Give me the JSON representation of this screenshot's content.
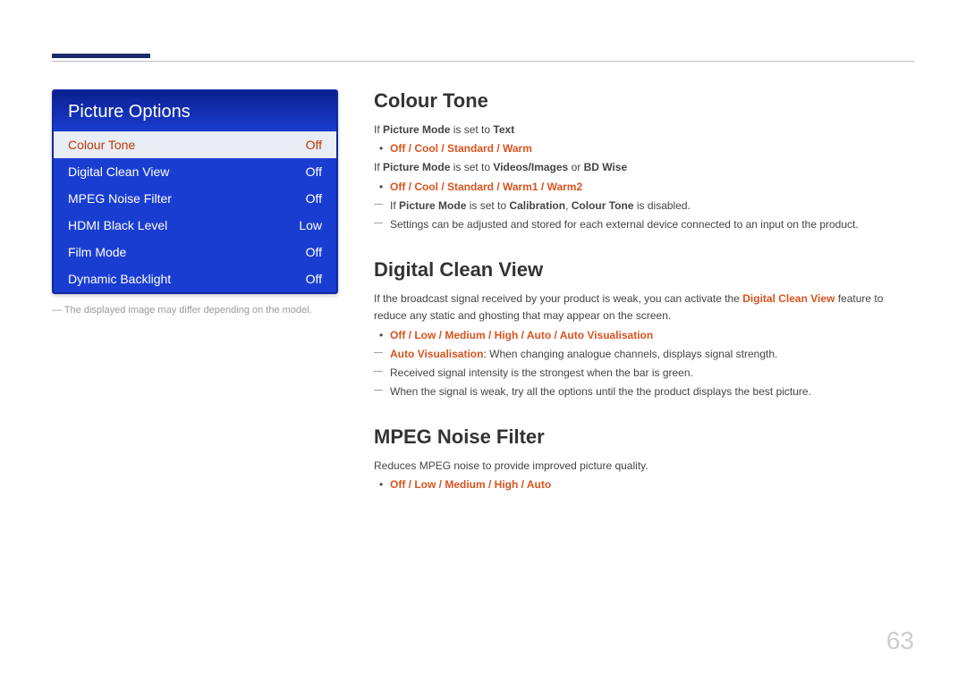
{
  "menu": {
    "title": "Picture Options",
    "items": [
      {
        "label": "Colour Tone",
        "value": "Off",
        "selected": true
      },
      {
        "label": "Digital Clean View",
        "value": "Off",
        "selected": false
      },
      {
        "label": "MPEG Noise Filter",
        "value": "Off",
        "selected": false
      },
      {
        "label": "HDMI Black Level",
        "value": "Low",
        "selected": false
      },
      {
        "label": "Film Mode",
        "value": "Off",
        "selected": false
      },
      {
        "label": "Dynamic Backlight",
        "value": "Off",
        "selected": false
      }
    ],
    "note": "The displayed image may differ depending on the model."
  },
  "sections": {
    "colourTone": {
      "title": "Colour Tone",
      "l1a": "If ",
      "l1b": "Picture Mode",
      "l1c": " is set to ",
      "l1d": "Text",
      "opt1": "Off / Cool / Standard / Warm",
      "l2a": "If ",
      "l2b": "Picture Mode",
      "l2c": " is set to ",
      "l2d": "Videos/Images",
      "l2e": " or ",
      "l2f": "BD Wise",
      "opt2": "Off / Cool / Standard / Warm1 / Warm2",
      "d1a": "If ",
      "d1b": "Picture Mode",
      "d1c": " is set to ",
      "d1d": "Calibration",
      "d1e": ", ",
      "d1f": "Colour Tone",
      "d1g": " is disabled.",
      "d2": "Settings can be adjusted and stored for each external device connected to an input on the product."
    },
    "dcv": {
      "title": "Digital Clean View",
      "p1a": "If the broadcast signal received by your product is weak, you can activate the ",
      "p1b": "Digital Clean View",
      "p1c": " feature to reduce any static and ghosting that may appear on the screen.",
      "opt": "Off / Low / Medium / High / Auto / Auto Visualisation",
      "d1a": "Auto Visualisation",
      "d1b": ": When changing analogue channels, displays signal strength.",
      "d2": "Received signal intensity is the strongest when the bar is green.",
      "d3": "When the signal is weak, try all the options until the the product displays the best picture."
    },
    "mpeg": {
      "title": "MPEG Noise Filter",
      "p1": "Reduces MPEG noise to provide improved picture quality.",
      "opt": "Off / Low / Medium / High / Auto"
    }
  },
  "pageNumber": "63"
}
